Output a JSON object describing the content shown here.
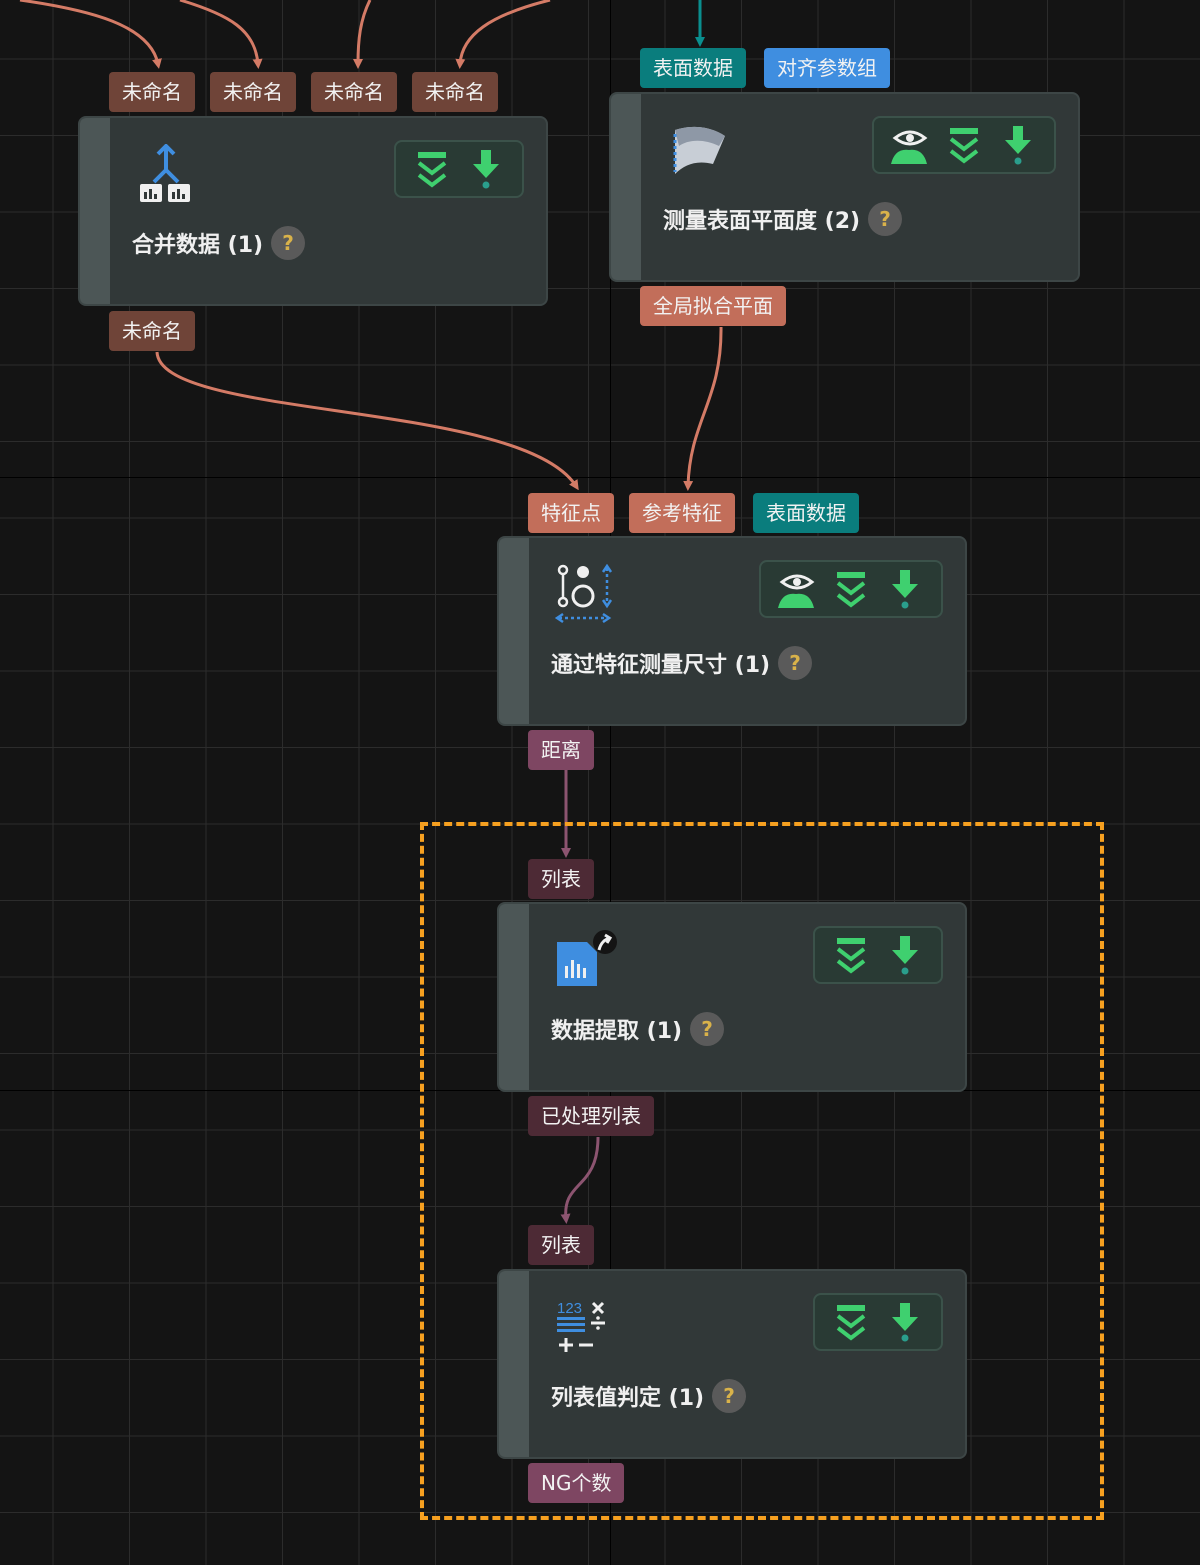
{
  "colors": {
    "background": "#141414",
    "grid": "#2c2c2c",
    "node": "#313838",
    "port_brown": "#6f4438",
    "port_salmon": "#c26e5a",
    "port_teal": "#0a7d7d",
    "port_blue": "#3f8ee0",
    "port_mauve": "#7e4662",
    "wire_salmon": "#d47b66",
    "wire_mauve": "#8c5470",
    "wire_teal": "#0a8f8f",
    "selection": "#f6a020",
    "help_icon": "#d9b24a",
    "toolbar_green": "#3fd06f"
  },
  "nodes": {
    "merge": {
      "title": "合并数据 (1)",
      "icon": "merge-data-icon",
      "inputs": [
        "未命名",
        "未命名",
        "未命名",
        "未命名"
      ],
      "outputs": [
        "未命名"
      ],
      "toolbar": [
        "step-over-icon",
        "download-icon"
      ]
    },
    "flatness": {
      "title": "测量表面平面度 (2)",
      "icon": "surface-flatness-icon",
      "inputs": [
        "表面数据",
        "对齐参数组"
      ],
      "outputs": [
        "全局拟合平面"
      ],
      "toolbar": [
        "visualize-icon",
        "step-over-icon",
        "download-icon"
      ]
    },
    "measure": {
      "title": "通过特征测量尺寸 (1)",
      "icon": "feature-measure-icon",
      "inputs": [
        "特征点",
        "参考特征",
        "表面数据"
      ],
      "outputs": [
        "距离"
      ],
      "toolbar": [
        "visualize-icon",
        "step-over-icon",
        "download-icon"
      ]
    },
    "extract": {
      "title": "数据提取 (1)",
      "icon": "data-extract-icon",
      "inputs": [
        "列表"
      ],
      "outputs": [
        "已处理列表"
      ],
      "toolbar": [
        "step-over-icon",
        "download-icon"
      ]
    },
    "judge": {
      "title": "列表值判定 (1)",
      "icon": "list-value-judge-icon",
      "inputs": [
        "列表"
      ],
      "outputs": [
        "NG个数"
      ],
      "toolbar": [
        "step-over-icon",
        "download-icon"
      ]
    }
  },
  "help_label": "?",
  "icon_text": {
    "judge_number": "123"
  }
}
